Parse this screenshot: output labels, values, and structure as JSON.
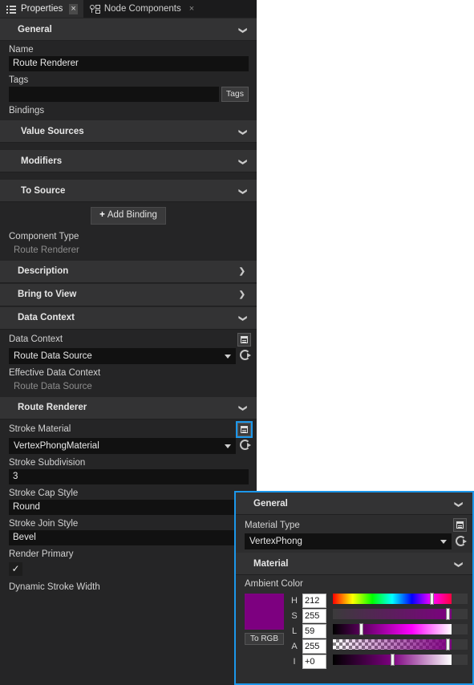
{
  "tabs": [
    {
      "label": "Properties",
      "icon": "list-icon",
      "active": true,
      "close": "×"
    },
    {
      "label": "Node Components",
      "icon": "node-components-icon",
      "active": false,
      "close": "×"
    }
  ],
  "panel": {
    "groups": {
      "general": "General",
      "description": "Description",
      "bring_to_view": "Bring to View",
      "data_context": "Data Context",
      "route_renderer": "Route Renderer",
      "value_sources": "Value Sources",
      "modifiers": "Modifiers",
      "to_source": "To Source"
    },
    "name": {
      "label": "Name",
      "value": "Route Renderer"
    },
    "tags": {
      "label": "Tags",
      "value": "",
      "button": "Tags"
    },
    "bindings": {
      "label": "Bindings",
      "add_button": "Add Binding",
      "plus": "+"
    },
    "component_type": {
      "label": "Component Type",
      "value": "Route Renderer"
    },
    "data_context_field": {
      "label": "Data Context",
      "value": "Route Data Source"
    },
    "effective_data_context": {
      "label": "Effective Data Context",
      "value": "Route Data Source"
    },
    "stroke_material": {
      "label": "Stroke Material",
      "value": "VertexPhongMaterial"
    },
    "stroke_subdivision": {
      "label": "Stroke Subdivision",
      "value": "3"
    },
    "stroke_cap_style": {
      "label": "Stroke Cap Style",
      "value": "Round"
    },
    "stroke_join_style": {
      "label": "Stroke Join Style",
      "value": "Bevel"
    },
    "render_primary": {
      "label": "Render Primary",
      "checked": "✓"
    },
    "dynamic_stroke_width": {
      "label": "Dynamic Stroke Width"
    },
    "chevron_down": "❯",
    "chevron_right": "❯"
  },
  "popup": {
    "groups": {
      "general": "General",
      "material": "Material"
    },
    "material_type": {
      "label": "Material Type",
      "value": "VertexPhong"
    },
    "ambient_color": {
      "label": "Ambient Color",
      "swatch_hex": "#7d0080",
      "to_rgb_button": "To RGB",
      "channels": [
        {
          "name": "H",
          "value": "212",
          "thumb_pct": 83
        },
        {
          "name": "S",
          "value": "255",
          "thumb_pct": 97
        },
        {
          "name": "L",
          "value": "59",
          "thumb_pct": 24
        },
        {
          "name": "A",
          "value": "255",
          "thumb_pct": 97
        },
        {
          "name": "I",
          "value": "+0",
          "thumb_pct": 50
        }
      ]
    }
  },
  "colors": {
    "accent": "#1c97ea",
    "panel_bg": "#252526",
    "group_bg": "#333334",
    "input_bg": "#111111",
    "swatch": "#7d0080"
  }
}
